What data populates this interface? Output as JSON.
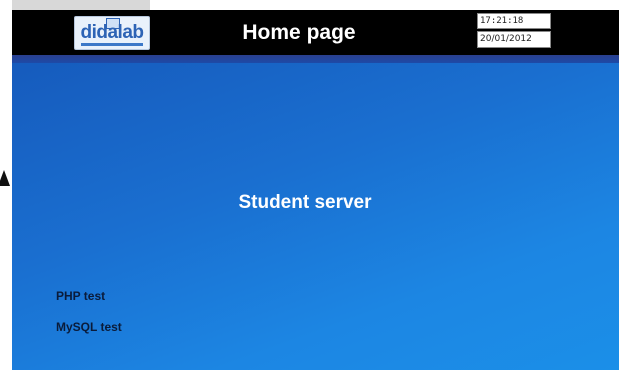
{
  "header": {
    "logo_text": "didalab",
    "title": "Home page",
    "time": "17:21:18",
    "date": "20/01/2012"
  },
  "main": {
    "title": "Student server",
    "links": [
      {
        "label": "PHP test"
      },
      {
        "label": "MySQL test"
      }
    ]
  },
  "colors": {
    "header_bg": "#000000",
    "screen_bg_start": "#1556b8",
    "screen_bg_end": "#1b8fe8",
    "link_text": "#0a1b3a"
  }
}
